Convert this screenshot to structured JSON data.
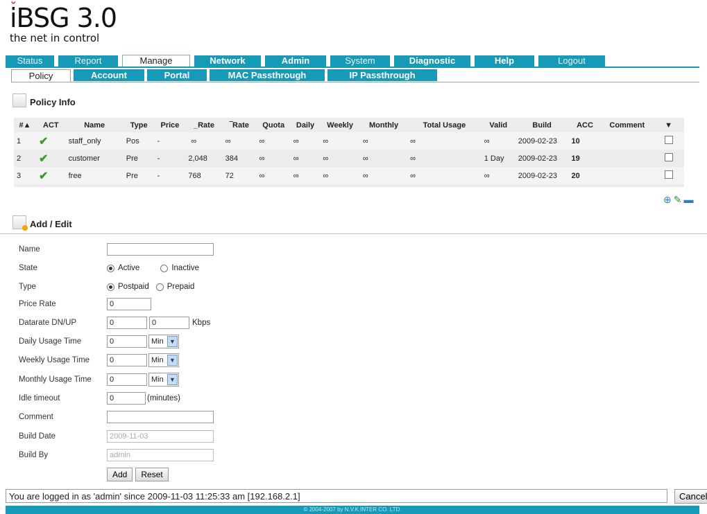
{
  "logo": {
    "main": "iBSG 3.0",
    "tagline": "the net in control"
  },
  "main_nav": [
    {
      "label": "Status",
      "bold": false,
      "active": false,
      "width": 70
    },
    {
      "label": "Report",
      "bold": false,
      "active": false,
      "width": 86
    },
    {
      "label": "Manage",
      "bold": false,
      "active": true,
      "width": 96
    },
    {
      "label": "Network",
      "bold": true,
      "active": false,
      "width": 96
    },
    {
      "label": "Admin",
      "bold": true,
      "active": false,
      "width": 88
    },
    {
      "label": "System",
      "bold": false,
      "active": false,
      "width": 86
    },
    {
      "label": "Diagnostic",
      "bold": true,
      "active": false,
      "width": 110
    },
    {
      "label": "Help",
      "bold": true,
      "active": false,
      "width": 86
    },
    {
      "label": "Logout",
      "bold": false,
      "active": false,
      "width": 96
    }
  ],
  "sub_nav": [
    {
      "label": "Policy",
      "active": true,
      "width": 84
    },
    {
      "label": "Account",
      "active": false,
      "width": 102
    },
    {
      "label": "Portal",
      "active": false,
      "width": 86
    },
    {
      "label": "MAC Passthrough",
      "active": false,
      "width": 166
    },
    {
      "label": "IP Passthrough",
      "active": false,
      "width": 158
    }
  ],
  "policy_info": {
    "title": "Policy Info",
    "columns": [
      "#▲",
      "ACT",
      "Name",
      "Type",
      "Price",
      "_Rate",
      "‾Rate",
      "Quota",
      "Daily",
      "Weekly",
      "Monthly",
      "Total Usage",
      "Valid",
      "Build",
      "ACC",
      "Comment",
      "▼"
    ],
    "rows": [
      {
        "num": "1",
        "name": "staff_only",
        "type": "Pos",
        "price": "-",
        "drate": "∞",
        "urate": "∞",
        "quota": "∞",
        "daily": "∞",
        "weekly": "∞",
        "monthly": "∞",
        "total": "∞",
        "valid": "∞",
        "build": "2009-02-23",
        "acc": "10",
        "comment": ""
      },
      {
        "num": "2",
        "name": "customer",
        "type": "Pre",
        "price": "-",
        "drate": "2,048",
        "urate": "384",
        "quota": "∞",
        "daily": "∞",
        "weekly": "∞",
        "monthly": "∞",
        "total": "∞",
        "valid": "1 Day",
        "build": "2009-02-23",
        "acc": "19",
        "comment": ""
      },
      {
        "num": "3",
        "name": "free",
        "type": "Pre",
        "price": "-",
        "drate": "768",
        "urate": "72",
        "quota": "∞",
        "daily": "∞",
        "weekly": "∞",
        "monthly": "∞",
        "total": "∞",
        "valid": "∞",
        "build": "2009-02-23",
        "acc": "20",
        "comment": ""
      }
    ],
    "actions": {
      "add_icon": "add-icon",
      "edit_icon": "edit-icon",
      "delete_icon": "delete-icon"
    }
  },
  "add_edit": {
    "title": "Add / Edit",
    "name_label": "Name",
    "name_value": "",
    "state_label": "State",
    "state_active": "Active",
    "state_inactive": "Inactive",
    "type_label": "Type",
    "type_postpaid": "Postpaid",
    "type_prepaid": "Prepaid",
    "price_label": "Price Rate",
    "price_value": "0",
    "datarate_label": "Datarate DN/UP",
    "datarate_dn": "0",
    "datarate_up": "0",
    "datarate_unit": "Kbps",
    "daily_label": "Daily Usage Time",
    "daily_value": "0",
    "daily_unit": "Min",
    "weekly_label": "Weekly Usage Time",
    "weekly_value": "0",
    "weekly_unit": "Min",
    "monthly_label": "Monthly Usage Time",
    "monthly_value": "0",
    "monthly_unit": "Min",
    "idle_label": "Idle timeout",
    "idle_value": "0",
    "idle_unit": "(minutes)",
    "comment_label": "Comment",
    "comment_value": "",
    "build_date_label": "Build Date",
    "build_date_value": "2009-11-03",
    "build_by_label": "Build By",
    "build_by_value": "admin",
    "add_button": "Add",
    "reset_button": "Reset"
  },
  "status": {
    "message": "You are logged in as 'admin' since 2009-11-03 11:25:33 am [192.168.2.1]",
    "cancel_button": "Cancel"
  },
  "footer": {
    "text": "© 2004-2007 by N.V.K.INTER CO. LTD."
  }
}
